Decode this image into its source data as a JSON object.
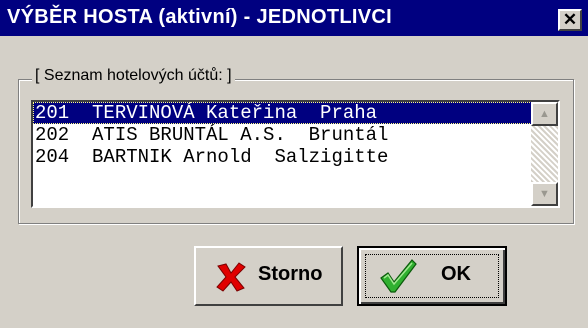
{
  "window": {
    "title": "VÝBĚR HOSTA (aktivní) - JEDNOTLIVCI",
    "close_glyph": "✕"
  },
  "group": {
    "label": "[ Seznam hotelových účtů: ]"
  },
  "list": {
    "rows": [
      {
        "text": "201  TERVINOVÁ Kateřina  Praha",
        "selected": true
      },
      {
        "text": "202  ATIS BRUNTÁL A.S.  Bruntál",
        "selected": false
      },
      {
        "text": "204  BARTNIK Arnold  Salzigitte",
        "selected": false
      }
    ],
    "scroll_up_glyph": "▲",
    "scroll_down_glyph": "▼"
  },
  "buttons": {
    "storno": {
      "label": "Storno",
      "icon": "red-x-icon",
      "color": "#e00000"
    },
    "ok": {
      "label": "OK",
      "icon": "green-check-icon",
      "color": "#20a020"
    }
  },
  "colors": {
    "titlebar": "#000080",
    "face": "#d4d0c8",
    "selection": "#000080"
  }
}
